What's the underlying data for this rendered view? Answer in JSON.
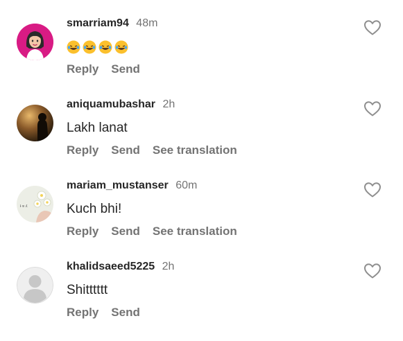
{
  "comments": [
    {
      "username": "smarriam94",
      "time": "48m",
      "text": "",
      "emoji": "😂😂😂😂",
      "reply_label": "Reply",
      "send_label": "Send",
      "translate_label": "",
      "avatar_icon": "avatar-bitmoji-woman"
    },
    {
      "username": "aniquamubashar",
      "time": "2h",
      "text": "Lakh lanat",
      "reply_label": "Reply",
      "send_label": "Send",
      "translate_label": "See translation",
      "avatar_icon": "avatar-sunset-silhouette"
    },
    {
      "username": "mariam_mustanser",
      "time": "60m",
      "text": "Kuch bhi!",
      "reply_label": "Reply",
      "send_label": "Send",
      "translate_label": "See translation",
      "avatar_icon": "avatar-flowers-hand",
      "avatar_text": "Ɨ ɐ ʎ"
    },
    {
      "username": "khalidsaeed5225",
      "time": "2h",
      "text": "Shitttttt",
      "reply_label": "Reply",
      "send_label": "Send",
      "translate_label": "",
      "avatar_icon": "avatar-default-placeholder"
    }
  ],
  "colors": {
    "primary_text": "#262626",
    "secondary_text": "#737373",
    "heart_outline": "#8e8e8e"
  },
  "icons": {
    "like": "heart-outline-icon"
  }
}
